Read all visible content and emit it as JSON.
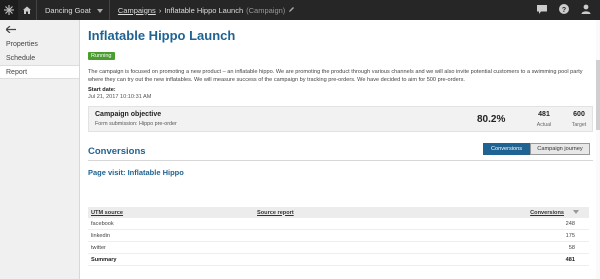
{
  "topbar": {
    "site_name": "Dancing Goat",
    "breadcrumb_link": "Campaigns",
    "breadcrumb_current": "Inflatable Hippo Launch",
    "breadcrumb_type": "(Campaign)"
  },
  "leftnav": {
    "items": [
      {
        "label": "Properties"
      },
      {
        "label": "Schedule"
      },
      {
        "label": "Report"
      }
    ]
  },
  "main": {
    "title": "Inflatable Hippo Launch",
    "status": "Running",
    "description": "The campaign is focused on promoting a new product – an inflatable hippo. We are promoting the product through various channels and we will also invite potential customers to a swimming pool party where they can try out the new inflatables. We will measure success of the campaign by tracking pre-orders. We have decided to aim for 500 pre-orders.",
    "start_date_label": "Start date:",
    "start_date_value": "Jul 21, 2017 10:10:31 AM"
  },
  "objective": {
    "title": "Campaign objective",
    "subtitle": "Form submission: Hippo pre-order",
    "percent": "80.2%",
    "actual_value": "481",
    "actual_label": "Actual",
    "target_value": "600",
    "target_label": "Target"
  },
  "tabs": {
    "conversions": "Conversions",
    "journey": "Campaign journey"
  },
  "conversions": {
    "heading": "Conversions",
    "subheading": "Page visit: Inflatable Hippo",
    "columns": {
      "utm_source": "UTM source",
      "source_report": "Source report",
      "conversions": "Conversions"
    },
    "rows": [
      {
        "source": "facebook",
        "count": "248"
      },
      {
        "source": "linkedin",
        "count": "175"
      },
      {
        "source": "twitter",
        "count": "58"
      }
    ],
    "summary_label": "Summary",
    "summary_count": "481"
  },
  "colors": {
    "topbar": "#262626",
    "accent": "#1f6393",
    "status_green": "#4a9e2f"
  }
}
